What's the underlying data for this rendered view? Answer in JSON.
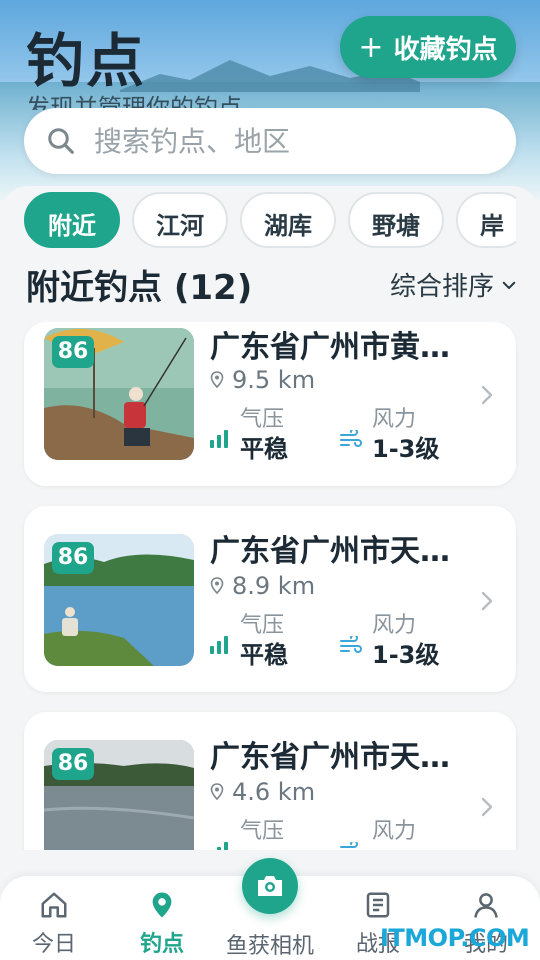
{
  "header": {
    "title": "钓点",
    "subtitle": "发现并管理你的钓点",
    "favorite_button": "收藏钓点",
    "favorite_icon": "plus-icon"
  },
  "search": {
    "placeholder": "搜索钓点、地区"
  },
  "chips": [
    "附近",
    "江河",
    "湖库",
    "野塘",
    "岸"
  ],
  "section": {
    "title": "附近钓点 (12)",
    "sort_label": "综合排序"
  },
  "spots": [
    {
      "score": "86",
      "name": "广东省广州市黄…",
      "distance": "9.5 km",
      "pressure_label": "气压",
      "pressure_value": "平稳",
      "wind_label": "风力",
      "wind_value": "1-3级"
    },
    {
      "score": "86",
      "name": "广东省广州市天…",
      "distance": "8.9 km",
      "pressure_label": "气压",
      "pressure_value": "平稳",
      "wind_label": "风力",
      "wind_value": "1-3级"
    },
    {
      "score": "86",
      "name": "广东省广州市天…",
      "distance": "4.6 km",
      "pressure_label": "气压",
      "pressure_value": "",
      "wind_label": "风力",
      "wind_value": ""
    }
  ],
  "tabbar": {
    "home": "今日",
    "spots": "钓点",
    "camera": "鱼获相机",
    "report": "战报",
    "me": "我的"
  },
  "watermark": "ITMOP.COM",
  "colors": {
    "accent": "#1fa58b",
    "text": "#1b2a35"
  }
}
